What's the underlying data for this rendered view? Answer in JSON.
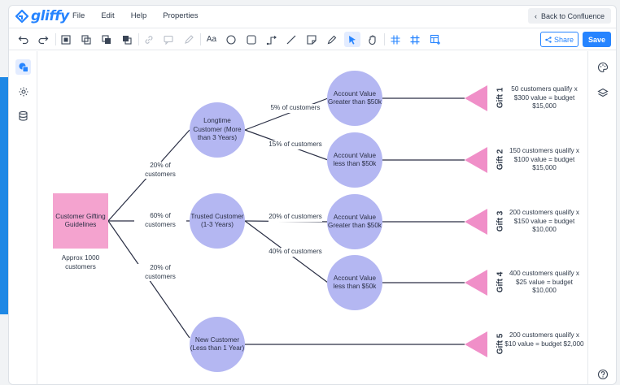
{
  "app": {
    "logo": "gliffy",
    "menu": [
      "File",
      "Edit",
      "Help",
      "Properties"
    ],
    "back_label": "Back to Confluence",
    "share_label": "Share",
    "save_label": "Save"
  },
  "toolbar_icons": [
    "undo-icon",
    "redo-icon",
    "select-all-icon",
    "group-icon",
    "bring-front-icon",
    "send-back-icon",
    "link-icon",
    "comment-icon",
    "edit-icon",
    "text-icon",
    "ellipse-icon",
    "rectangle-icon",
    "connector-icon",
    "line-icon",
    "note-icon",
    "pencil-icon",
    "pointer-icon",
    "hand-icon",
    "grid-icon",
    "table-icon",
    "table-plus-icon"
  ],
  "diagram": {
    "root": {
      "label": "Customer Gifting Guidelines",
      "caption": "Approx 1000 customers"
    },
    "branch_labels": {
      "longtime": "20% of customers",
      "trusted": "60% of customers",
      "new": "20% of customers",
      "lt_gt50": "5% of customers",
      "lt_lt50": "15% of customers",
      "tr_gt50": "20% of customers",
      "tr_lt50": "40% of customers"
    },
    "segments": {
      "longtime": "Longtime Customer (More than 3 Years)",
      "trusted": "Trusted Customer (1-3 Years)",
      "new": "New Customer (Less than 1 Year)"
    },
    "values": {
      "v1": "Account Value Greater than $50k",
      "v2": "Account Value less than $50k",
      "v3": "Account Value Greater than $50k",
      "v4": "Account Value less than $50k"
    },
    "gifts": [
      {
        "label": "Gift 1",
        "desc": "50 customers qualify x $300 value = budget $15,000"
      },
      {
        "label": "Gift 2",
        "desc": "150 customers qualify x $100 value = budget $15,000"
      },
      {
        "label": "Gift 3",
        "desc": "200 customers qualify x $150 value = budget $10,000"
      },
      {
        "label": "Gift 4",
        "desc": "400 customers qualify x $25 value = budget $10,000"
      },
      {
        "label": "Gift 5",
        "desc": "200 customers qualify x $10 value = budget $2,000"
      }
    ]
  },
  "colors": {
    "accent": "#2684ff",
    "circle": "#b4b7f2",
    "square": "#f4a3cf",
    "triangle": "#f08fc8"
  }
}
